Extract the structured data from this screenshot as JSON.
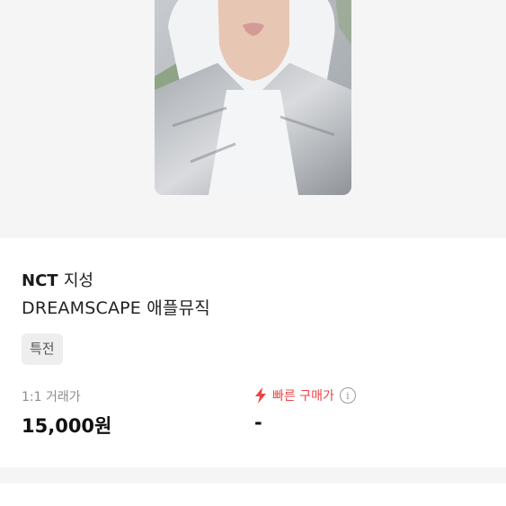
{
  "product": {
    "artist": "NCT",
    "member": "지성",
    "album": "DREAMSCAPE 애플뮤직",
    "tag": "특전"
  },
  "pricing": {
    "trade_label": "1:1 거래가",
    "trade_price": "15,000원",
    "fast_label": "빠른 구매가",
    "fast_price": "-",
    "fast_color": "#ef4444",
    "fast_icon": "lightning-bolt-icon",
    "help_icon": "info-circle-icon",
    "help_glyph": "i"
  }
}
